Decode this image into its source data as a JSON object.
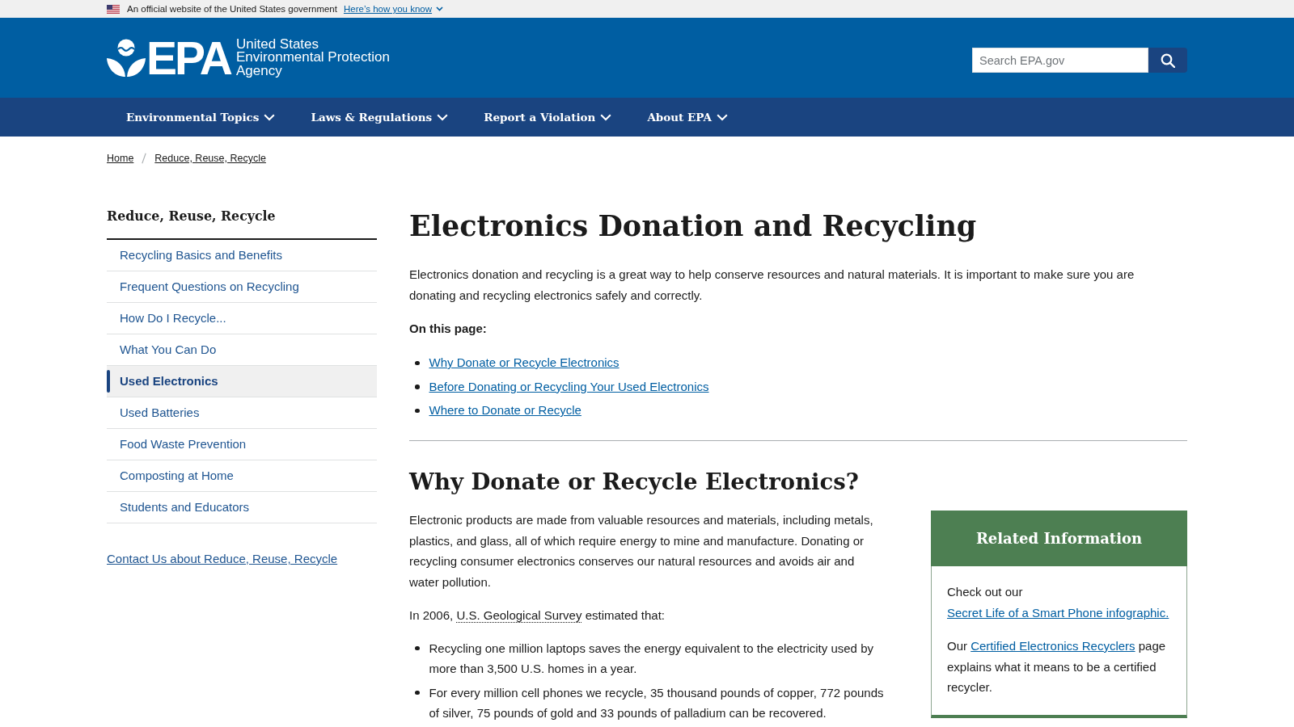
{
  "gov_banner": {
    "text": "An official website of the United States government",
    "link": "Here’s how you know"
  },
  "header": {
    "logo": {
      "acronym": "EPA",
      "name_lines": [
        "United States",
        "Environmental Protection",
        "Agency"
      ]
    },
    "search": {
      "placeholder": "Search EPA.gov"
    }
  },
  "nav": {
    "items": [
      {
        "label": "Environmental Topics"
      },
      {
        "label": "Laws & Regulations"
      },
      {
        "label": "Report a Violation"
      },
      {
        "label": "About EPA"
      }
    ]
  },
  "breadcrumb": {
    "items": [
      {
        "label": "Home"
      },
      {
        "label": "Reduce, Reuse, Recycle"
      }
    ]
  },
  "sidebar": {
    "title": "Reduce, Reuse, Recycle",
    "items": [
      {
        "label": "Recycling Basics and Benefits",
        "selected": false
      },
      {
        "label": "Frequent Questions on Recycling",
        "selected": false
      },
      {
        "label": "How Do I Recycle...",
        "selected": false
      },
      {
        "label": "What You Can Do",
        "selected": false
      },
      {
        "label": "Used Electronics",
        "selected": true
      },
      {
        "label": "Used Batteries",
        "selected": false
      },
      {
        "label": "Food Waste Prevention",
        "selected": false
      },
      {
        "label": "Composting at Home",
        "selected": false
      },
      {
        "label": "Students and Educators",
        "selected": false
      }
    ],
    "contact_link": "Contact Us about Reduce, Reuse, Recycle"
  },
  "main": {
    "title": "Electronics Donation and Recycling",
    "intro": "Electronics donation and recycling is a great way to help conserve resources and natural materials. It is important to make sure you are donating and recycling electronics safely and correctly.",
    "on_this_page": {
      "label": "On this page:",
      "links": [
        "Why Donate or Recycle Electronics",
        "Before Donating or Recycling Your Used Electronics",
        "Where to Donate or Recycle"
      ]
    },
    "section": {
      "heading": "Why Donate or Recycle Electronics?",
      "paragraph": "Electronic products are made from valuable resources and materials, including metals, plastics, and glass, all of which require energy to mine and manufacture. Donating or recycling consumer electronics conserves our natural resources and avoids air and water pollution.",
      "source_sentence": [
        {
          "kind": "text",
          "text": "In 2006,"
        },
        {
          "kind": "term",
          "text": "U.S. Geological Survey"
        },
        {
          "kind": "text",
          "text": "estimated that:"
        }
      ],
      "facts": [
        "Recycling one million laptops saves the energy equivalent to the electricity used by more than 3,500 U.S. homes in a year.",
        "For every million cell phones we recycle, 35 thousand pounds of copper, 772 pounds of silver, 75 pounds of gold and 33 pounds of palladium can be recovered."
      ],
      "related_information": {
        "title": "Related Information",
        "paragraphs": [
          {
            "segments": [
              {
                "kind": "text",
                "text": "Check out our"
              },
              {
                "kind": "link",
                "text": "Secret Life of a Smart Phone infographic."
              }
            ]
          },
          {
            "segments": [
              {
                "kind": "text",
                "text": "Our"
              },
              {
                "kind": "link",
                "text": "Certified Electronics Recyclers"
              },
              {
                "kind": "text",
                "text": "page explains what it means to be a certified recycler."
              }
            ]
          }
        ]
      }
    }
  }
}
